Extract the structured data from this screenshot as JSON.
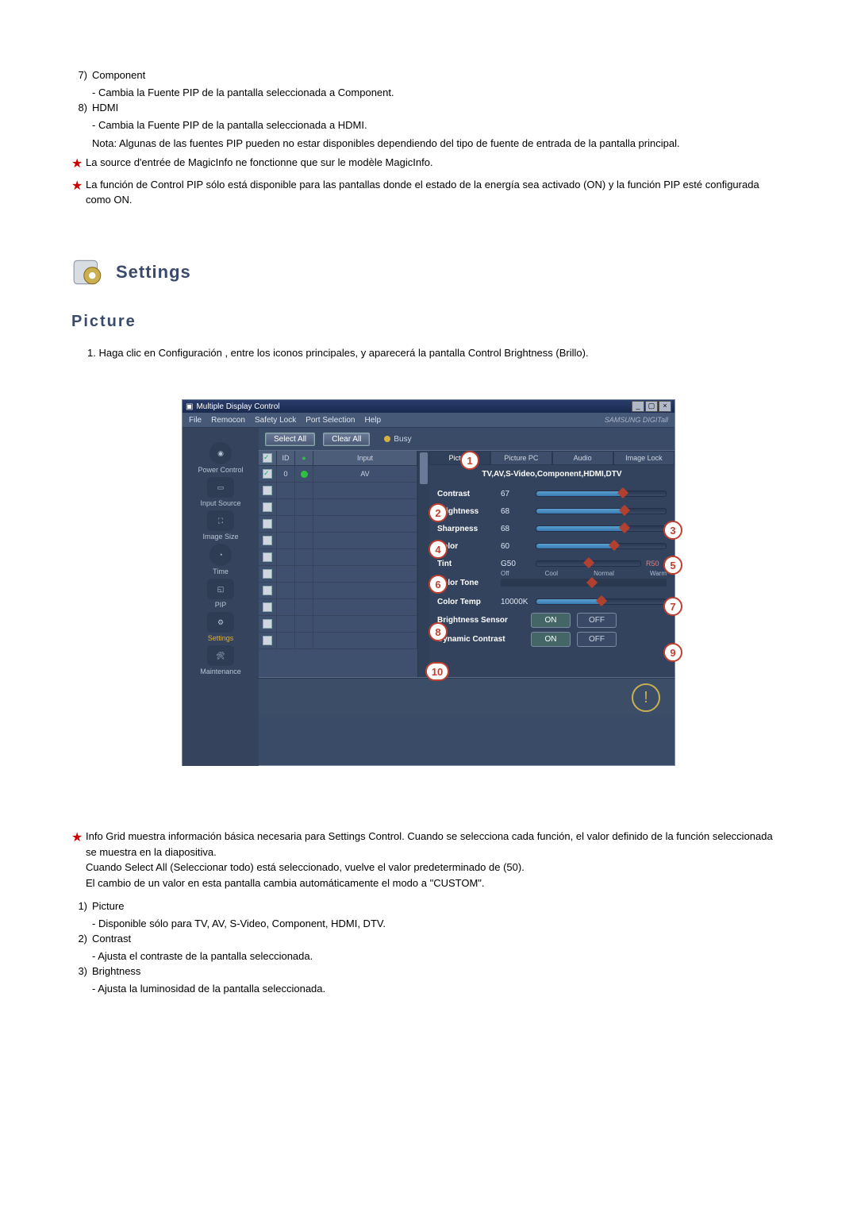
{
  "top_list": [
    {
      "num": "7)",
      "title": "Component",
      "desc": "- Cambia la Fuente PIP de la pantalla seleccionada a Component."
    },
    {
      "num": "8)",
      "title": "HDMI",
      "desc": "- Cambia la Fuente PIP de la pantalla seleccionada a HDMI."
    }
  ],
  "top_note": "Nota: Algunas de las fuentes PIP pueden no estar disponibles dependiendo del tipo de fuente de entrada de la pantalla principal.",
  "top_stars": [
    "La source d'entrée de MagicInfo ne fonctionne que sur le modèle MagicInfo.",
    "La función de Control PIP sólo está disponible para las pantallas donde el estado de la energía sea activado (ON) y la función PIP esté configurada como ON."
  ],
  "section_title": "Settings",
  "subhead": "Picture",
  "intro_num": "1.",
  "intro": "Haga clic en Configuración , entre los iconos principales, y aparecerá la pantalla Control Brightness (Brillo).",
  "app": {
    "title": "Multiple Display Control",
    "menus": [
      "File",
      "Remocon",
      "Safety Lock",
      "Port Selection",
      "Help"
    ],
    "brand": "SAMSUNG DIGITall",
    "sidebar": [
      {
        "label": "Power Control"
      },
      {
        "label": "Input Source"
      },
      {
        "label": "Image Size"
      },
      {
        "label": "Time"
      },
      {
        "label": "PIP"
      },
      {
        "label": "Settings",
        "selected": true
      },
      {
        "label": "Maintenance"
      }
    ],
    "toolbar": {
      "select_all": "Select All",
      "clear_all": "Clear All",
      "busy": "Busy"
    },
    "grid": {
      "headers": {
        "c1": "☑",
        "c2": "ID",
        "c3": "●",
        "c4": "Input"
      },
      "rows": [
        {
          "checked": true,
          "id": "0",
          "status": "on",
          "input": "AV"
        },
        {
          "checked": false,
          "id": "",
          "status": "",
          "input": ""
        },
        {
          "checked": false,
          "id": "",
          "status": "",
          "input": ""
        },
        {
          "checked": false,
          "id": "",
          "status": "",
          "input": ""
        },
        {
          "checked": false,
          "id": "",
          "status": "",
          "input": ""
        },
        {
          "checked": false,
          "id": "",
          "status": "",
          "input": ""
        },
        {
          "checked": false,
          "id": "",
          "status": "",
          "input": ""
        },
        {
          "checked": false,
          "id": "",
          "status": "",
          "input": ""
        },
        {
          "checked": false,
          "id": "",
          "status": "",
          "input": ""
        },
        {
          "checked": false,
          "id": "",
          "status": "",
          "input": ""
        },
        {
          "checked": false,
          "id": "",
          "status": "",
          "input": ""
        }
      ]
    },
    "tabs": [
      "Picture",
      "Picture PC",
      "Audio",
      "Image Lock"
    ],
    "tab_active": 0,
    "panel_sub": "TV,AV,S-Video,Component,HDMI,DTV",
    "sliders": [
      {
        "label": "Contrast",
        "val": "67",
        "pct": 67
      },
      {
        "label": "Brightness",
        "val": "68",
        "pct": 68
      },
      {
        "label": "Sharpness",
        "val": "68",
        "pct": 68
      },
      {
        "label": "Color",
        "val": "60",
        "pct": 60
      }
    ],
    "tint": {
      "label": "Tint",
      "left": "G50",
      "right": "R50",
      "pct": 50
    },
    "color_tone": {
      "label": "Color Tone",
      "opts": [
        "Off",
        "Cool",
        "Normal",
        "Warm"
      ],
      "sel_pct": 55
    },
    "color_temp": {
      "label": "Color Temp",
      "val": "10000K",
      "pct": 50
    },
    "toggles": [
      {
        "label": "Brightness Sensor",
        "on": "ON",
        "off": "OFF"
      },
      {
        "label": "Dynamic Contrast",
        "on": "ON",
        "off": "OFF"
      }
    ]
  },
  "callouts": {
    "1": "1",
    "2": "2",
    "3": "3",
    "4": "4",
    "5": "5",
    "6": "6",
    "7": "7",
    "8": "8",
    "9": "9",
    "10": "10"
  },
  "bottom_star": {
    "l1": "Info Grid muestra información básica necesaria para Settings Control. Cuando se selecciona cada función, el valor definido de la función seleccionada se muestra en la diapositiva.",
    "l2": "Cuando Select All (Seleccionar todo) está seleccionado, vuelve el valor predeterminado de (50).",
    "l3": "El cambio de un valor en esta pantalla cambia automáticamente el modo a \"CUSTOM\"."
  },
  "bottom_list": [
    {
      "num": "1)",
      "title": "Picture",
      "desc": "- Disponible sólo para TV, AV, S-Video, Component, HDMI, DTV."
    },
    {
      "num": "2)",
      "title": "Contrast",
      "desc": "- Ajusta el contraste de la pantalla seleccionada."
    },
    {
      "num": "3)",
      "title": "Brightness",
      "desc": "- Ajusta la luminosidad de la pantalla seleccionada."
    }
  ]
}
